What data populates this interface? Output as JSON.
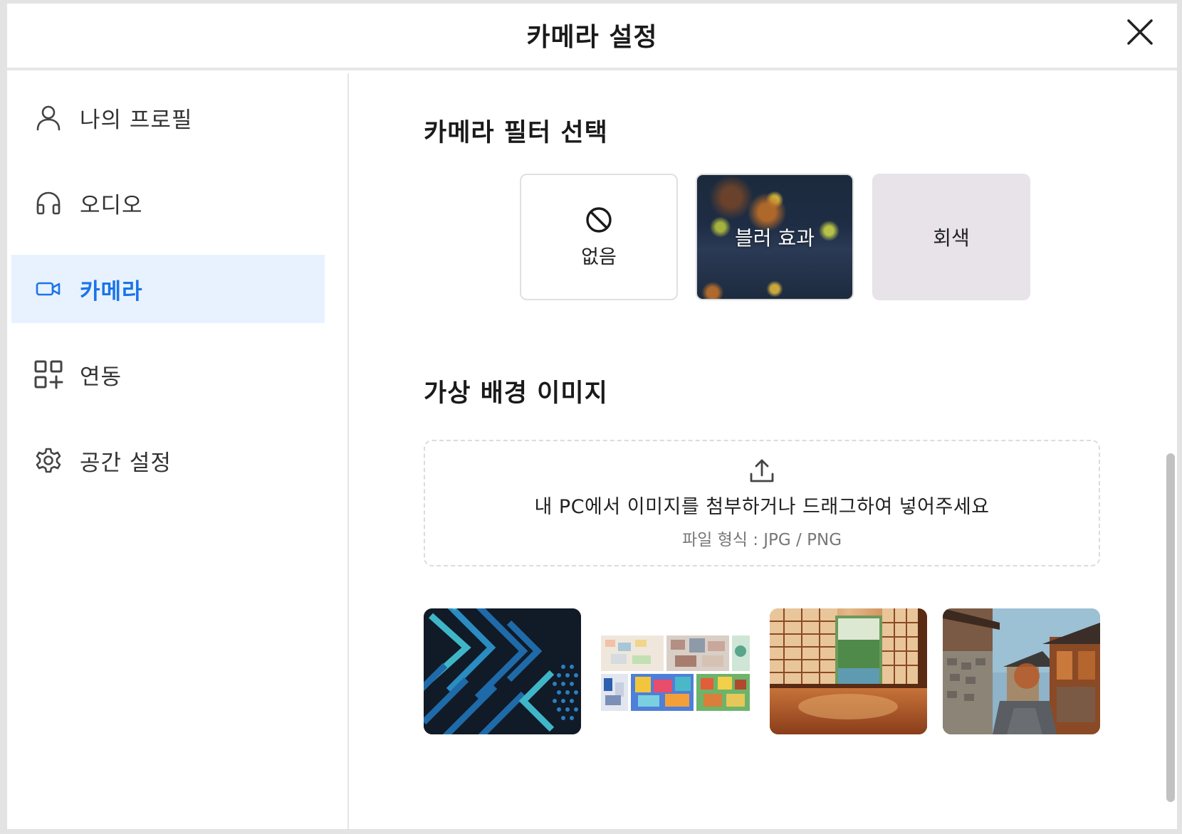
{
  "dialog": {
    "title": "카메라 설정"
  },
  "sidebar": {
    "items": [
      {
        "label": "나의 프로필",
        "icon": "user-icon",
        "active": false
      },
      {
        "label": "오디오",
        "icon": "headphones-icon",
        "active": false
      },
      {
        "label": "카메라",
        "icon": "video-camera-icon",
        "active": true
      },
      {
        "label": "연동",
        "icon": "apps-add-icon",
        "active": false
      },
      {
        "label": "공간 설정",
        "icon": "gear-icon",
        "active": false
      }
    ]
  },
  "filters": {
    "title": "카메라 필터 선택",
    "options": [
      {
        "label": "없음",
        "icon": "prohibited-icon"
      },
      {
        "label": "블러 효과"
      },
      {
        "label": "회색"
      }
    ]
  },
  "backgrounds": {
    "title": "가상 배경 이미지",
    "upload": {
      "label": "내 PC에서 이미지를 첨부하거나 드래그하여 넣어주세요",
      "formats": "파일 형식 : JPG / PNG",
      "icon": "upload-icon"
    },
    "thumbnails": [
      {
        "name": "geometric-pattern"
      },
      {
        "name": "isometric-city"
      },
      {
        "name": "hanok-room-window"
      },
      {
        "name": "hanok-alley"
      }
    ]
  },
  "colors": {
    "accent": "#1b74e8",
    "active_bg": "#e8f2ff",
    "gray_filter": "#e7e3e8"
  }
}
